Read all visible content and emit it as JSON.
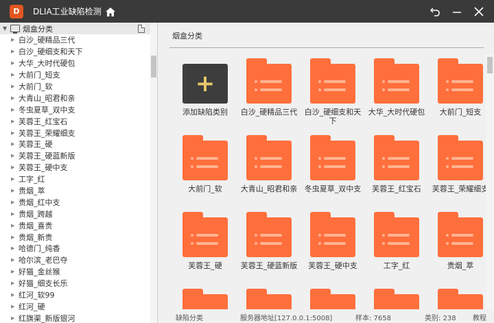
{
  "titlebar": {
    "logo_letter": "D",
    "title": "DLIA工业缺陷检测",
    "home_icon": "home-icon",
    "back_icon": "back-icon",
    "minimize_icon": "minimize-icon",
    "close_icon": "close-icon"
  },
  "tree": {
    "root_label": "烟盒分类",
    "items": [
      "白沙_硬精品三代",
      "白沙_硬细支和天下",
      "大华_大时代硬包",
      "大前门_短支",
      "大前门_软",
      "大青山_昭君和亲",
      "冬虫夏草_双中支",
      "芙蓉王_红宝石",
      "芙蓉王_荣耀细支",
      "芙蓉王_硬",
      "芙蓉王_硬蓝新版",
      "芙蓉王_硬中支",
      "工字_红",
      "贵烟_萃",
      "贵烟_红中支",
      "贵烟_跨越",
      "贵烟_喜贵",
      "贵烟_新贵",
      "哈德门_纯香",
      "哈尔滨_老巴夺",
      "好猫_金丝猴",
      "好猫_细支长乐",
      "红河_软99",
      "红河_硬",
      "红旗渠_新版银河"
    ]
  },
  "main": {
    "title": "烟盒分类",
    "add_label": "添加缺陷类别",
    "folders": [
      "白沙_硬精品三代",
      "白沙_硬细支和天下",
      "大华_大时代硬包",
      "大前门_短支",
      "大前门_软",
      "大青山_昭君和亲",
      "冬虫夏草_双中支",
      "芙蓉王_红宝石",
      "芙蓉王_荣耀细支",
      "芙蓉王_硬",
      "芙蓉王_硬蓝新版",
      "芙蓉王_硬中支",
      "工字_红",
      "贵烟_萃",
      "",
      "",
      "",
      "",
      ""
    ]
  },
  "status": {
    "category": "缺陷分类",
    "server": "服务器地址[127.0.0.1:5008]",
    "samples": "样本: 7658",
    "classes": "类别: 238",
    "tutorial": "教程"
  },
  "colors": {
    "titlebar": "#3a3a3a",
    "folder": "#ff6f3c",
    "folder_stripe": "#ffb492",
    "add_tile": "#3d3d3d",
    "add_plus": "#e7c86b"
  }
}
